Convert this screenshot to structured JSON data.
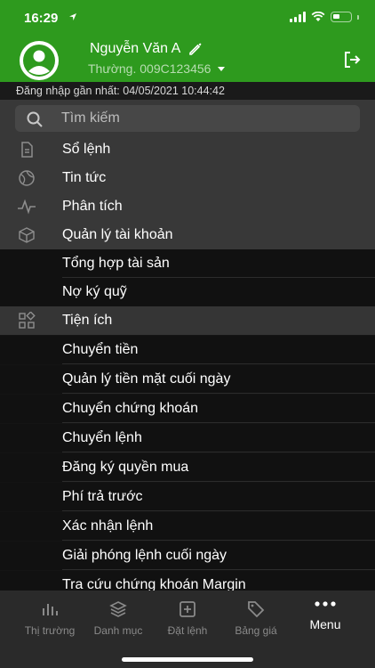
{
  "status": {
    "time": "16:29",
    "location_icon": "location-arrow-icon"
  },
  "header": {
    "user_name": "Nguyễn Văn A",
    "account": "Thường. 009C123456",
    "accent": "#2e9a1e"
  },
  "last_login": "Đăng nhập gần nhất: 04/05/2021 10:44:42",
  "search": {
    "placeholder": "Tìm kiếm"
  },
  "menu": {
    "items": [
      {
        "label": "Sổ lệnh",
        "icon": "document-icon"
      },
      {
        "label": "Tin tức",
        "icon": "news-globe-icon"
      },
      {
        "label": "Phân tích",
        "icon": "pulse-icon"
      },
      {
        "label": "Quản lý tài khoản",
        "icon": "box-icon"
      }
    ],
    "account_sub": [
      {
        "label": "Tổng hợp tài sản"
      },
      {
        "label": "Nợ ký quỹ"
      }
    ],
    "utility": {
      "label": "Tiện ích",
      "icon": "grid-apps-icon"
    },
    "utility_sub": [
      {
        "label": "Chuyển tiền"
      },
      {
        "label": "Quản lý tiền mặt cuối ngày"
      },
      {
        "label": "Chuyển chứng khoán"
      },
      {
        "label": "Chuyển lệnh"
      },
      {
        "label": "Đăng ký quyền mua"
      },
      {
        "label": "Phí trả trước"
      },
      {
        "label": "Xác nhận lệnh"
      },
      {
        "label": "Giải phóng lệnh cuối ngày"
      },
      {
        "label": "Tra cứu chứng khoán Margin"
      }
    ]
  },
  "bottom_nav": [
    {
      "label": "Thị trường",
      "icon": "bar-chart-icon"
    },
    {
      "label": "Danh mục",
      "icon": "layers-icon"
    },
    {
      "label": "Đặt lệnh",
      "icon": "plus-square-icon"
    },
    {
      "label": "Bảng giá",
      "icon": "tag-icon"
    },
    {
      "label": "Menu",
      "icon": "more-dots-icon",
      "active": true
    }
  ]
}
